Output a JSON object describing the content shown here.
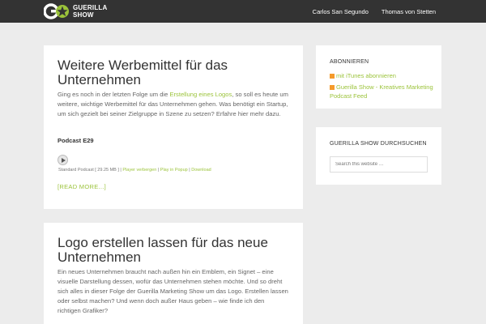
{
  "site": {
    "logo_line1": "Guerilla",
    "logo_line2": "Show"
  },
  "nav": {
    "items": [
      "Carlos San Segundo",
      "Thomas von Stetten"
    ]
  },
  "posts": [
    {
      "title": "Weitere Werbemittel für das Unternehmen",
      "body_before_link": "Ging es noch in der letzten Folge um die ",
      "body_link": "Erstellung eines Logos",
      "body_after_link": ", so soll es heute um weitere, wichtige Werbemittel für das Unternehmen gehen. Was benötigt ein Startup, um sich gezielt bei seiner Zielgruppe in Szene zu setzen? Erfahre hier mehr dazu.",
      "podcast_label": "Podcast E29",
      "podcast_meta": "Standard Podcast [ 29.25 MB ]",
      "player_links": [
        "Player verbergen",
        "Play in Popup",
        "Download"
      ],
      "readmore": "[READ MORE...]"
    },
    {
      "title": "Logo erstellen lassen für das neue Unternehmen",
      "body": "Ein neues Unternehmen braucht nach außen hin ein Emblem, ein Signet – eine visuelle Darstellung dessen, wofür das Unternehmen stehen möchte. Und so dreht sich alles in dieser Folge der Guerilla Marketing Show um das Logo. Erstellen lassen oder selbst machen? Und wenn doch außer Haus geben – wie finde ich den richtigen Grafiker?"
    }
  ],
  "sidebar": {
    "subscribe_title": "Abonnieren",
    "subscribe_items": [
      "mit iTunes abonnieren",
      "Guerilla Show - Kreatives Marketing Podcast Feed"
    ],
    "search_title": "Guerilla Show durchsuchen",
    "search_placeholder": "Search this website …"
  },
  "colors": {
    "accent": "#9bc33a",
    "topbar": "#333333",
    "background": "#ececec"
  }
}
